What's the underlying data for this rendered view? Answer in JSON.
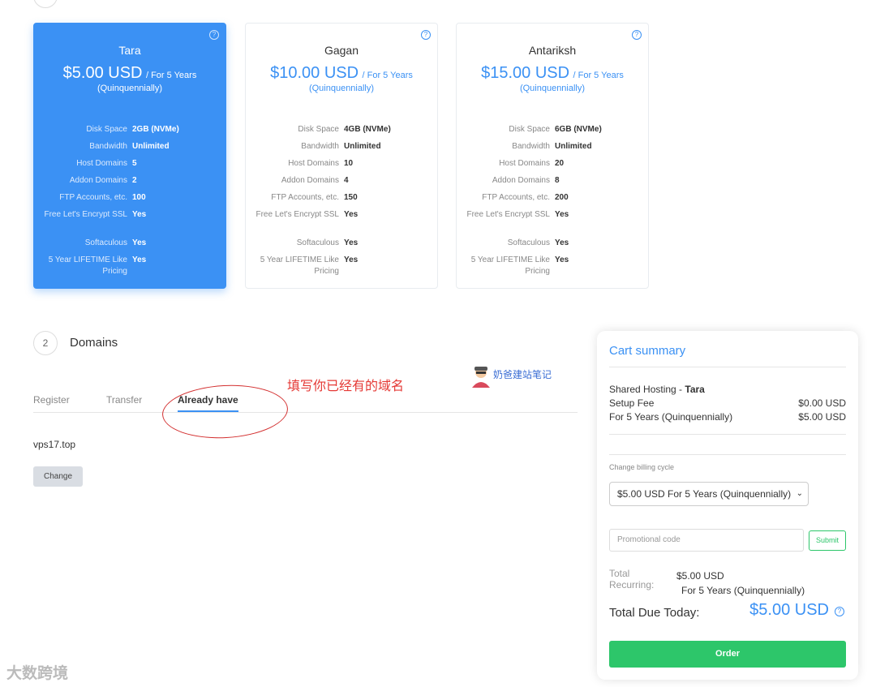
{
  "plans": [
    {
      "name": "Tara",
      "price": "$5.00 USD",
      "cycle": "/ For 5 Years",
      "cycle_note": "(Quinquennially)",
      "selected": true,
      "features": [
        {
          "k": "Disk Space",
          "v": "2GB (NVMe)"
        },
        {
          "k": "Bandwidth",
          "v": "Unlimited"
        },
        {
          "k": "Host Domains",
          "v": "5"
        },
        {
          "k": "Addon Domains",
          "v": "2"
        },
        {
          "k": "FTP Accounts, etc.",
          "v": "100"
        },
        {
          "k": "Free Let's Encrypt SSL",
          "v": "Yes"
        },
        {
          "k": "Softaculous",
          "v": "Yes"
        },
        {
          "k": "5 Year LIFETIME Like Pricing",
          "v": "Yes"
        }
      ]
    },
    {
      "name": "Gagan",
      "price": "$10.00 USD",
      "cycle": "/ For 5 Years",
      "cycle_note": "(Quinquennially)",
      "selected": false,
      "features": [
        {
          "k": "Disk Space",
          "v": "4GB (NVMe)"
        },
        {
          "k": "Bandwidth",
          "v": "Unlimited"
        },
        {
          "k": "Host Domains",
          "v": "10"
        },
        {
          "k": "Addon Domains",
          "v": "4"
        },
        {
          "k": "FTP Accounts, etc.",
          "v": "150"
        },
        {
          "k": "Free Let's Encrypt SSL",
          "v": "Yes"
        },
        {
          "k": "Softaculous",
          "v": "Yes"
        },
        {
          "k": "5 Year LIFETIME Like Pricing",
          "v": "Yes"
        }
      ]
    },
    {
      "name": "Antariksh",
      "price": "$15.00 USD",
      "cycle": "/ For 5 Years",
      "cycle_note": "(Quinquennially)",
      "selected": false,
      "features": [
        {
          "k": "Disk Space",
          "v": "6GB (NVMe)"
        },
        {
          "k": "Bandwidth",
          "v": "Unlimited"
        },
        {
          "k": "Host Domains",
          "v": "20"
        },
        {
          "k": "Addon Domains",
          "v": "8"
        },
        {
          "k": "FTP Accounts, etc.",
          "v": "200"
        },
        {
          "k": "Free Let's Encrypt SSL",
          "v": "Yes"
        },
        {
          "k": "Softaculous",
          "v": "Yes"
        },
        {
          "k": "5 Year LIFETIME Like Pricing",
          "v": "Yes"
        }
      ]
    }
  ],
  "domains": {
    "step_number": "2",
    "title": "Domains",
    "tabs": [
      "Register",
      "Transfer",
      "Already have"
    ],
    "active_tab": "Already have",
    "domain_value": "vps17.top",
    "change_label": "Change"
  },
  "annotation": {
    "text": "填写你已经有的域名",
    "watermark_top": "奶爸建站笔记",
    "watermark_bottom": "大数跨境"
  },
  "cart": {
    "title": "Cart summary",
    "product": "Shared Hosting - ",
    "product_name": "Tara",
    "setup_label": "Setup Fee",
    "setup_value": "$0.00 USD",
    "cycle_label": "For 5 Years (Quinquennially)",
    "cycle_value": "$5.00 USD",
    "billing_label": "Change billing cycle",
    "billing_value": "$5.00 USD For 5 Years (Quinquennially)",
    "promo_placeholder": "Promotional code",
    "submit_label": "Submit",
    "total_recurring_label": "Total Recurring:",
    "total_recurring_amount": "$5.00 USD",
    "total_recurring_cycle": "For 5 Years (Quinquennially)",
    "due_label": "Total Due Today:",
    "due_amount": "$5.00 USD",
    "order_label": "Order"
  }
}
